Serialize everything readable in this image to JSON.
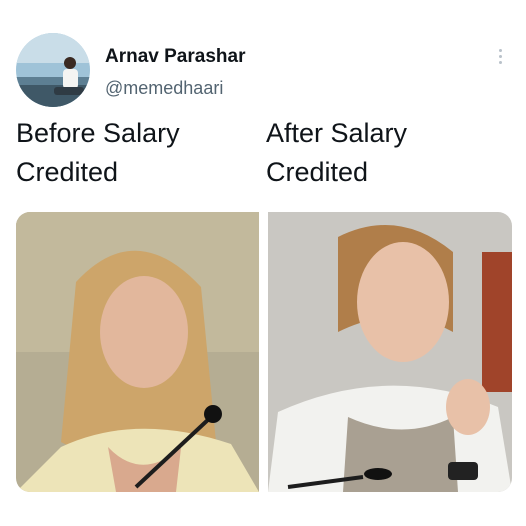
{
  "tweet": {
    "author_name": "Arnav Parashar",
    "author_handle": "@memedhaari",
    "avatar_icon": "profile-photo-avatar",
    "more_icon": "more-vertical-icon",
    "captions": {
      "left_line1": "Before Salary",
      "left_line2": "Credited",
      "right_line1": "After Salary",
      "right_line2": "Credited"
    },
    "photos": [
      {
        "name": "before-salary-photo"
      },
      {
        "name": "after-salary-photo"
      }
    ]
  },
  "colors": {
    "name_text": "#0f1419",
    "handle_text": "#536471",
    "more_dots": "#b9c2ca"
  }
}
